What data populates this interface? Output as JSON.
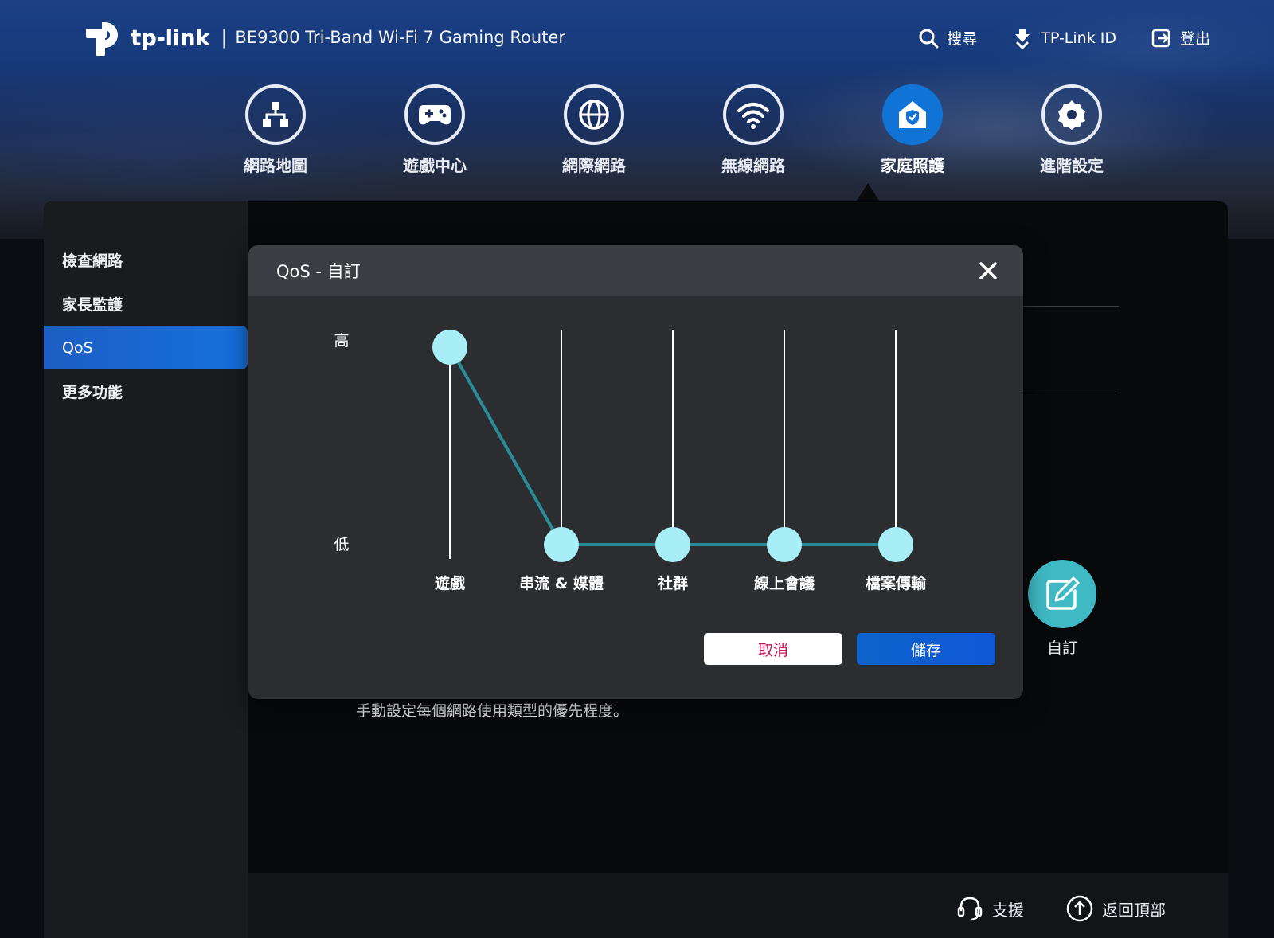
{
  "header": {
    "brand": "tp-link",
    "separator": "|",
    "model": "BE9300 Tri-Band Wi-Fi 7 Gaming Router",
    "actions": [
      {
        "label": "搜尋",
        "icon": "search-icon"
      },
      {
        "label": "TP-Link ID",
        "icon": "tplink-id-icon"
      },
      {
        "label": "登出",
        "icon": "logout-icon"
      }
    ]
  },
  "nav": [
    {
      "label": "網路地圖",
      "icon": "network-map-icon",
      "active": false
    },
    {
      "label": "遊戲中心",
      "icon": "gamepad-icon",
      "active": false
    },
    {
      "label": "網際網路",
      "icon": "globe-icon",
      "active": false
    },
    {
      "label": "無線網路",
      "icon": "wifi-icon",
      "active": false
    },
    {
      "label": "家庭照護",
      "icon": "home-care-icon",
      "active": true
    },
    {
      "label": "進階設定",
      "icon": "gear-icon",
      "active": false
    }
  ],
  "sidebar": {
    "items": [
      {
        "label": "檢查網路",
        "active": false
      },
      {
        "label": "家長監護",
        "active": false
      },
      {
        "label": "QoS",
        "active": true
      },
      {
        "label": "更多功能",
        "active": false
      }
    ]
  },
  "content": {
    "custom_mode_label": "自訂",
    "description": "手動設定每個網路使用類型的優先程度。"
  },
  "footer": {
    "support_label": "支援",
    "back_to_top_label": "返回頂部"
  },
  "modal": {
    "title": "QoS - 自訂",
    "y_high_label": "高",
    "y_low_label": "低",
    "cancel_label": "取消",
    "save_label": "儲存"
  },
  "chart_data": {
    "type": "line",
    "categories": [
      "遊戲",
      "串流 & 媒體",
      "社群",
      "線上會議",
      "檔案傳輸"
    ],
    "values": [
      1,
      0,
      0,
      0,
      0
    ],
    "ylim": [
      0,
      1
    ],
    "ytick_labels": [
      "低",
      "高"
    ],
    "colors": {
      "line": "#2a8c96",
      "marker": "#a8eef6",
      "track": "#ffffff"
    },
    "grid": false
  }
}
